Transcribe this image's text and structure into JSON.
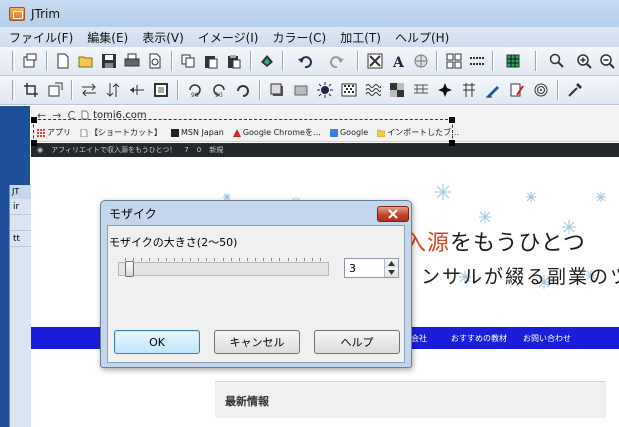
{
  "app": {
    "title": "JTrim",
    "menus": [
      "ファイル(F)",
      "編集(E)",
      "表示(V)",
      "イメージ(I)",
      "カラー(C)",
      "加工(T)",
      "ヘルプ(H)"
    ]
  },
  "toolbar1": {
    "icons": [
      "new-window-icon",
      "new-file-icon",
      "open-folder-icon",
      "save-icon",
      "print-icon",
      "print-preview-icon",
      "copy-icon",
      "paste-icon",
      "paste-new-icon",
      "hand-tool-icon",
      "undo-icon",
      "redo-icon",
      "fit-window-icon",
      "text-icon",
      "spot-icon",
      "grid-icon",
      "dash-line-icon",
      "color-table-icon",
      "zoom-menu-icon",
      "zoom-in-icon",
      "zoom-out-icon"
    ]
  },
  "toolbar2": {
    "icons": [
      "crop-icon",
      "resize-icon",
      "flip-horizontal-icon",
      "flip-vertical-icon",
      "horizontal-arrow-icon",
      "frame-icon",
      "rotate-90-left-icon",
      "rotate-90-right-icon",
      "rotate-icon",
      "shadow-icon",
      "gray-icon",
      "sun-icon",
      "dither-icon",
      "wave-icon",
      "mosaic-icon",
      "emboss-icon",
      "sparkle-icon",
      "edge-icon",
      "pen-icon",
      "brush-icon",
      "swirl-icon",
      "eyedropper-icon"
    ],
    "rotate_label_left": "90",
    "rotate_label_right": "90"
  },
  "browser": {
    "url": "tomi6.com",
    "bookmarks": [
      "アプリ",
      "【ショートカット】",
      "MSN Japan",
      "Google Chromeを…",
      "Google",
      "インポートしたブ…"
    ],
    "wp_bar_text": "アフィリエイトで収入源をもうひとつ！",
    "wp_count_1": "7",
    "wp_count_2": "0",
    "wp_new": "新規"
  },
  "website": {
    "title_accent": "収入源",
    "title_rest": "をもうひとつ",
    "subtitle": "ンサルが綴る副業のツ",
    "nav_links": [
      "会社",
      "おすすめの教材",
      "お問い合わせ"
    ],
    "news_heading": "最新情報"
  },
  "inner_window": {
    "title": "JT",
    "row1": "ir",
    "row2": "",
    "row3": "tt"
  },
  "dialog": {
    "title": "モザイク",
    "label": "モザイクの大きさ(2〜50)",
    "value": "3",
    "slider_min": 2,
    "slider_max": 50,
    "slider_value": 3,
    "ok": "OK",
    "cancel": "キャンセル",
    "help": "ヘルプ"
  },
  "colors": {
    "title_bar": "#b6cfe9",
    "nav_blue": "#1b1ed8",
    "accent_orange": "#d54a22",
    "close_red": "#c4442a"
  }
}
